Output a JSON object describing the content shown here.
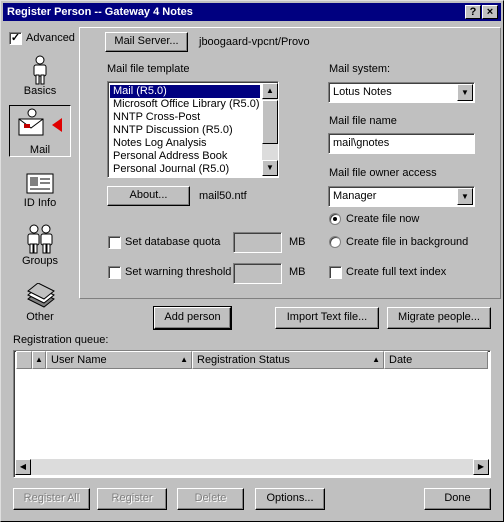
{
  "window": {
    "title": "Register Person -- Gateway 4 Notes",
    "help_btn": "?",
    "close_btn": "×"
  },
  "sidebar": {
    "advanced_label": "Advanced",
    "advanced_checked": true,
    "items": [
      {
        "label": "Basics",
        "icon": "person-icon"
      },
      {
        "label": "Mail",
        "icon": "mail-envelope-icon",
        "selected": true
      },
      {
        "label": "ID Info",
        "icon": "id-card-icon"
      },
      {
        "label": "Groups",
        "icon": "group-people-icon"
      },
      {
        "label": "Other",
        "icon": "stack-icon"
      }
    ]
  },
  "mail": {
    "server_button": "Mail Server...",
    "server_value": "jboogaard-vpcnt/Provo",
    "template_label": "Mail file template",
    "templates": [
      "Mail (R5.0)",
      "Microsoft Office Library (R5.0)",
      "NNTP Cross-Post",
      "NNTP Discussion (R5.0)",
      "Notes Log Analysis",
      "Personal Address Book",
      "Personal Journal (R5.0)"
    ],
    "about_button": "About...",
    "template_file": "mail50.ntf",
    "db_quota_label": "Set database quota",
    "db_quota_unit": "MB",
    "warning_label": "Set warning threshold",
    "warning_unit": "MB",
    "system_label": "Mail system:",
    "system_value": "Lotus Notes",
    "file_name_label": "Mail file name",
    "file_name_value": "mail\\gnotes",
    "owner_access_label": "Mail file owner access",
    "owner_access_value": "Manager",
    "create_now_label": "Create file now",
    "create_background_label": "Create file in background",
    "full_text_label": "Create full text index"
  },
  "actions": {
    "add_person": "Add person",
    "import_text": "Import Text file...",
    "migrate": "Migrate people..."
  },
  "queue": {
    "label": "Registration queue:",
    "columns": [
      "User Name",
      "Registration Status",
      "Date"
    ]
  },
  "footer": {
    "register_all": "Register All",
    "register": "Register",
    "delete": "Delete",
    "options": "Options...",
    "done": "Done"
  }
}
